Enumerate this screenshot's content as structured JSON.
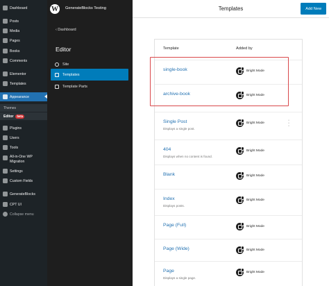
{
  "wp_admin_menu": {
    "items": [
      {
        "label": "Dashboard",
        "icon": "dashboard-icon"
      },
      {
        "label": "Posts",
        "icon": "posts-icon"
      },
      {
        "label": "Media",
        "icon": "media-icon"
      },
      {
        "label": "Pages",
        "icon": "pages-icon"
      },
      {
        "label": "Books",
        "icon": "books-icon"
      },
      {
        "label": "Comments",
        "icon": "comments-icon"
      },
      {
        "label": "Elementor",
        "icon": "elementor-icon"
      },
      {
        "label": "Templates",
        "icon": "templates-icon"
      },
      {
        "label": "Appearance",
        "icon": "appearance-icon"
      },
      {
        "label": "Plugins",
        "icon": "plugins-icon"
      },
      {
        "label": "Users",
        "icon": "users-icon"
      },
      {
        "label": "Tools",
        "icon": "tools-icon"
      },
      {
        "label": "All-in-One WP Migration",
        "icon": "migration-icon"
      },
      {
        "label": "Settings",
        "icon": "settings-icon"
      },
      {
        "label": "Custom Fields",
        "icon": "custom-fields-icon"
      },
      {
        "label": "GenerateBlocks",
        "icon": "generateblocks-icon"
      },
      {
        "label": "CPT UI",
        "icon": "cpt-ui-icon"
      },
      {
        "label": "Collapse menu",
        "icon": "collapse-icon"
      }
    ],
    "submenu": [
      {
        "label": "Themes"
      },
      {
        "label": "Editor",
        "badge": "beta"
      }
    ]
  },
  "editor": {
    "site_title": "GenerateBlocks Testing",
    "back_label": "Dashboard",
    "heading": "Editor",
    "nav": [
      {
        "label": "Site"
      },
      {
        "label": "Templates"
      },
      {
        "label": "Template Parts"
      }
    ]
  },
  "header": {
    "title": "Templates",
    "add_new_label": "Add New"
  },
  "table": {
    "columns": [
      "Template",
      "Added by"
    ],
    "rows": [
      {
        "name": "single-book",
        "description": "",
        "added_by": "Bright Mode"
      },
      {
        "name": "archive-book",
        "description": "",
        "added_by": "Bright Mode"
      },
      {
        "name": "Single Post",
        "description": "Displays a single post.",
        "added_by": "Bright Mode"
      },
      {
        "name": "404",
        "description": "Displays when no content is found.",
        "added_by": "Bright Mode"
      },
      {
        "name": "Blank",
        "description": "",
        "added_by": "Bright Mode"
      },
      {
        "name": "Index",
        "description": "Displays posts.",
        "added_by": "Bright Mode"
      },
      {
        "name": "Page (Full)",
        "description": "",
        "added_by": "Bright Mode"
      },
      {
        "name": "Page (Wide)",
        "description": "",
        "added_by": "Bright Mode"
      },
      {
        "name": "Page",
        "description": "Displays a single page.",
        "added_by": "Bright Mode"
      }
    ]
  },
  "colors": {
    "accent": "#007cba",
    "link": "#2271b1",
    "highlight_border": "#d9474a",
    "admin_bar": "#1d2327"
  }
}
